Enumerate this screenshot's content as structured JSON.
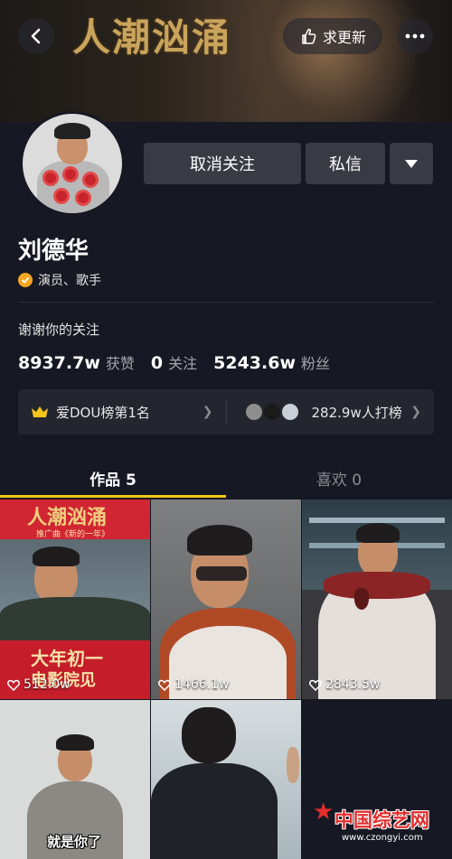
{
  "banner": {
    "title_art": "人潮汹涌"
  },
  "header": {
    "update_label": "求更新"
  },
  "profile": {
    "name": "刘德华",
    "verified_text": "演员、歌手",
    "bio": "谢谢你的关注",
    "buttons": {
      "unfollow": "取消关注",
      "message": "私信"
    },
    "stats": [
      {
        "num": "8937.7w",
        "label": "获赞"
      },
      {
        "num": "0",
        "label": "关注"
      },
      {
        "num": "5243.6w",
        "label": "粉丝"
      }
    ]
  },
  "rank": {
    "left": "爱DOU榜第1名",
    "right": "282.9w人打榜"
  },
  "tabs": [
    {
      "label": "作品 5"
    },
    {
      "label": "喜欢 0"
    }
  ],
  "videos": [
    {
      "likes": "512.0w",
      "poster_title": "人潮汹涌",
      "poster_sub": "推广曲《新的一年》",
      "poster_big": "大年初一",
      "poster_big2": "电影院见"
    },
    {
      "likes": "1466.1w"
    },
    {
      "likes": "2843.5w"
    },
    {
      "caption": "就是你了"
    },
    {}
  ],
  "watermark": {
    "text": "中国综艺网",
    "url": "www.czongyi.com"
  },
  "colors": {
    "background": "#161823",
    "accent": "#f5c518",
    "button_bg": "#393b44"
  }
}
